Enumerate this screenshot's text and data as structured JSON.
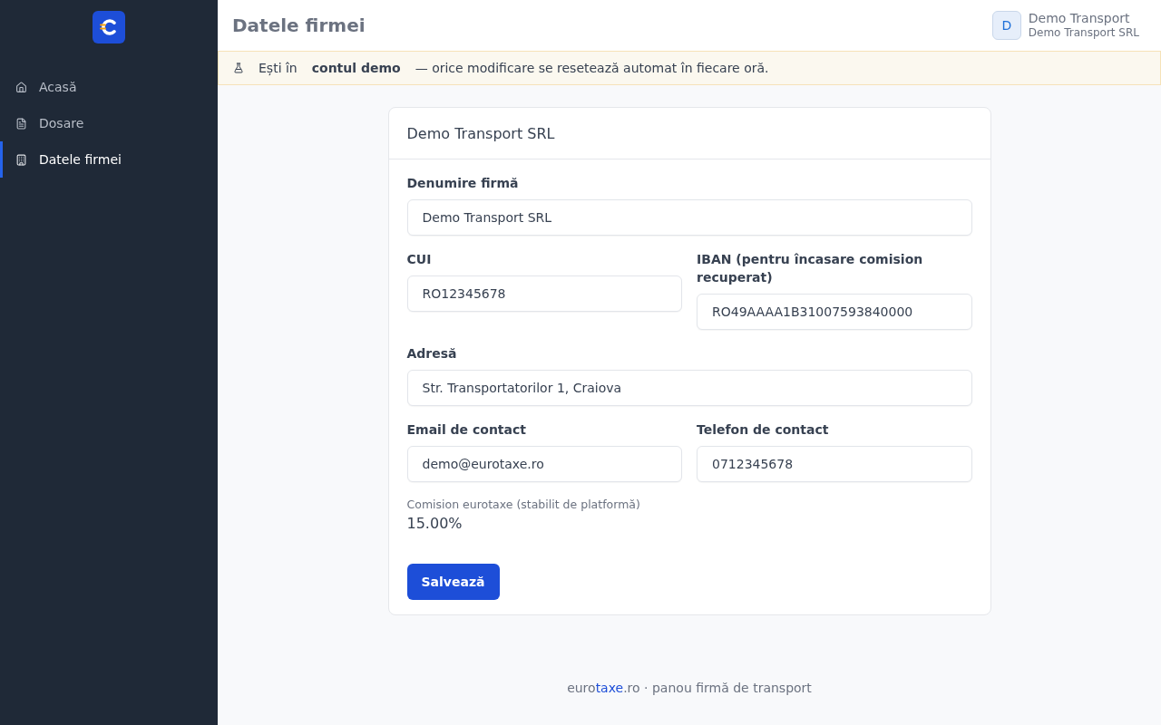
{
  "sidebar": {
    "items": [
      {
        "label": "Acasă",
        "selected": false
      },
      {
        "label": "Dosare",
        "selected": false
      },
      {
        "label": "Datele firmei",
        "selected": true
      }
    ]
  },
  "header": {
    "title": "Datele firmei",
    "user": {
      "initial": "D",
      "name": "Demo Transport",
      "company": "Demo Transport SRL"
    }
  },
  "notice": {
    "parts": [
      {
        "text": "Ești în",
        "bold": false
      },
      {
        "text": "contul demo",
        "bold": true
      },
      {
        "text": "— orice modificare se resetează automat în fiecare oră.",
        "bold": false
      }
    ]
  },
  "card": {
    "title": "Demo Transport SRL",
    "fields": [
      {
        "label": "Denumire firmă",
        "value": "Demo Transport SRL",
        "kind": "wide"
      },
      {
        "label": "CUI",
        "value": "RO12345678",
        "kind": "narrow"
      },
      {
        "label": "IBAN (pentru încasare comision recuperat)",
        "value": "RO49AAAA1B31007593840000",
        "kind": "narrow"
      },
      {
        "label": "Adresă",
        "value": "Str. Transportatorilor 1, Craiova",
        "kind": "wide"
      },
      {
        "label": "Email de contact",
        "value": "demo@eurotaxe.ro",
        "kind": "narrow"
      },
      {
        "label": "Telefon de contact",
        "value": "0712345678",
        "kind": "narrow"
      }
    ],
    "commission": {
      "label": "Comision eurotaxe (stabilit de platformă)",
      "value": "15.00%"
    },
    "save_button": "Salvează"
  },
  "footer": {
    "parts": [
      {
        "text": "euro",
        "highlight": false
      },
      {
        "text": "taxe",
        "highlight": true
      },
      {
        "text": ".ro · panou firmă de transport",
        "highlight": false
      }
    ]
  }
}
